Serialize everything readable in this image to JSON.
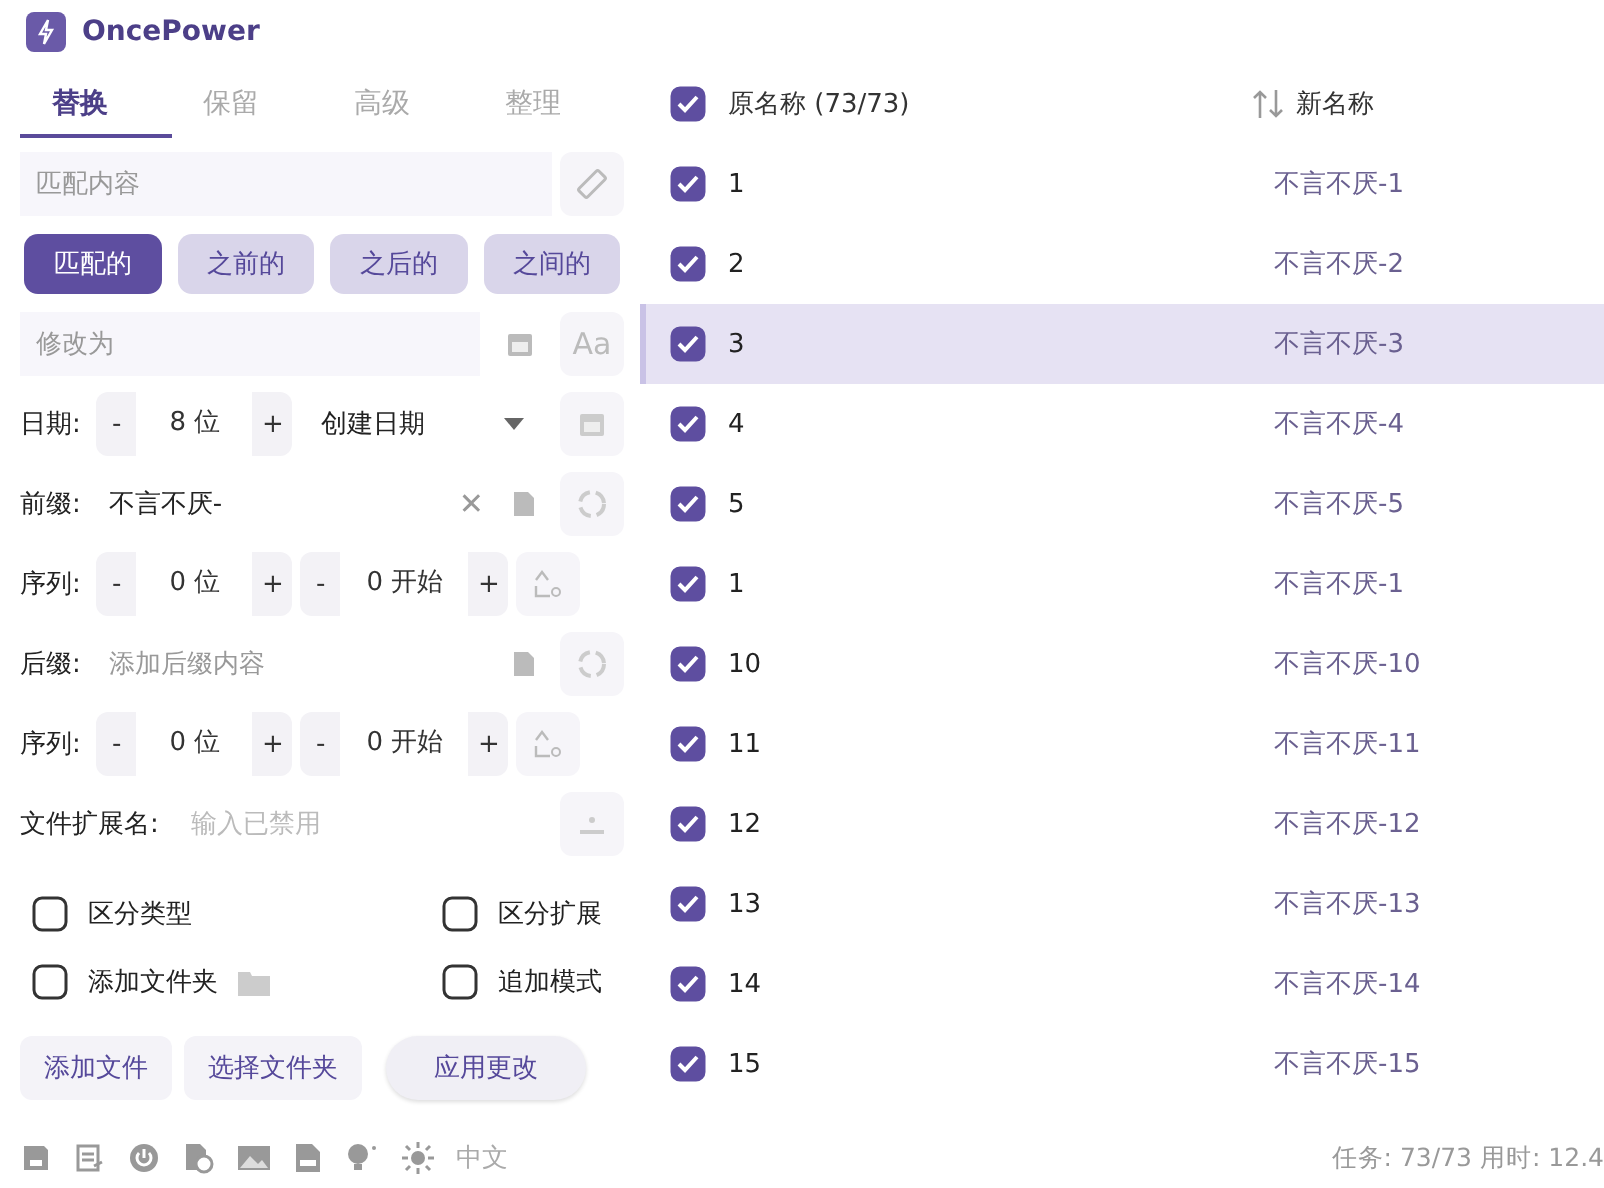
{
  "app": {
    "title": "OncePower"
  },
  "tabs": [
    {
      "label": "替换",
      "selected": true
    },
    {
      "label": "保留",
      "selected": false
    },
    {
      "label": "高级",
      "selected": false
    },
    {
      "label": "整理",
      "selected": false
    }
  ],
  "match": {
    "placeholder": "匹配内容"
  },
  "modes": [
    {
      "label": "匹配的",
      "selected": true
    },
    {
      "label": "之前的",
      "selected": false
    },
    {
      "label": "之后的",
      "selected": false
    },
    {
      "label": "之间的",
      "selected": false
    }
  ],
  "modify": {
    "placeholder": "修改为",
    "case_button": "Aa"
  },
  "date": {
    "label": "日期:",
    "minus": "-",
    "value": "8 位",
    "plus": "+",
    "type": "创建日期"
  },
  "prefix": {
    "label": "前缀:",
    "value": "不言不厌-",
    "clear": "✕"
  },
  "prefix_sequence": {
    "label": "序列:",
    "digits": {
      "minus": "-",
      "value": "0 位",
      "plus": "+"
    },
    "start": {
      "minus": "-",
      "value": "0 开始",
      "plus": "+"
    }
  },
  "suffix": {
    "label": "后缀:",
    "placeholder": "添加后缀内容"
  },
  "suffix_sequence": {
    "label": "序列:",
    "digits": {
      "minus": "-",
      "value": "0 位",
      "plus": "+"
    },
    "start": {
      "minus": "-",
      "value": "0 开始",
      "plus": "+"
    }
  },
  "extension": {
    "label": "文件扩展名:",
    "placeholder": "输入已禁用",
    "disabled": true
  },
  "options": [
    {
      "label": "区分类型",
      "checked": false,
      "kind": "plain"
    },
    {
      "label": "区分扩展",
      "checked": false,
      "kind": "plain"
    },
    {
      "label": "添加文件夹",
      "checked": false,
      "kind": "folder"
    },
    {
      "label": "追加模式",
      "checked": false,
      "kind": "plain"
    }
  ],
  "actions": [
    {
      "label": "添加文件",
      "kind": "flat"
    },
    {
      "label": "选择文件夹",
      "kind": "flat"
    },
    {
      "label": "应用更改",
      "kind": "pill"
    }
  ],
  "language": "中文",
  "table": {
    "header": {
      "original": "原名称 (73/73)",
      "new": "新名称",
      "checked": true
    },
    "rows": [
      {
        "original": "1",
        "new": "不言不厌-1",
        "checked": true,
        "selected": false
      },
      {
        "original": "2",
        "new": "不言不厌-2",
        "checked": true,
        "selected": false
      },
      {
        "original": "3",
        "new": "不言不厌-3",
        "checked": true,
        "selected": true
      },
      {
        "original": "4",
        "new": "不言不厌-4",
        "checked": true,
        "selected": false
      },
      {
        "original": "5",
        "new": "不言不厌-5",
        "checked": true,
        "selected": false
      },
      {
        "original": "1",
        "new": "不言不厌-1",
        "checked": true,
        "selected": false
      },
      {
        "original": "10",
        "new": "不言不厌-10",
        "checked": true,
        "selected": false
      },
      {
        "original": "11",
        "new": "不言不厌-11",
        "checked": true,
        "selected": false
      },
      {
        "original": "12",
        "new": "不言不厌-12",
        "checked": true,
        "selected": false
      },
      {
        "original": "13",
        "new": "不言不厌-13",
        "checked": true,
        "selected": false
      },
      {
        "original": "14",
        "new": "不言不厌-14",
        "checked": true,
        "selected": false
      },
      {
        "original": "15",
        "new": "不言不厌-15",
        "checked": true,
        "selected": false
      }
    ]
  },
  "status": "任务: 73/73 用时: 12.4"
}
